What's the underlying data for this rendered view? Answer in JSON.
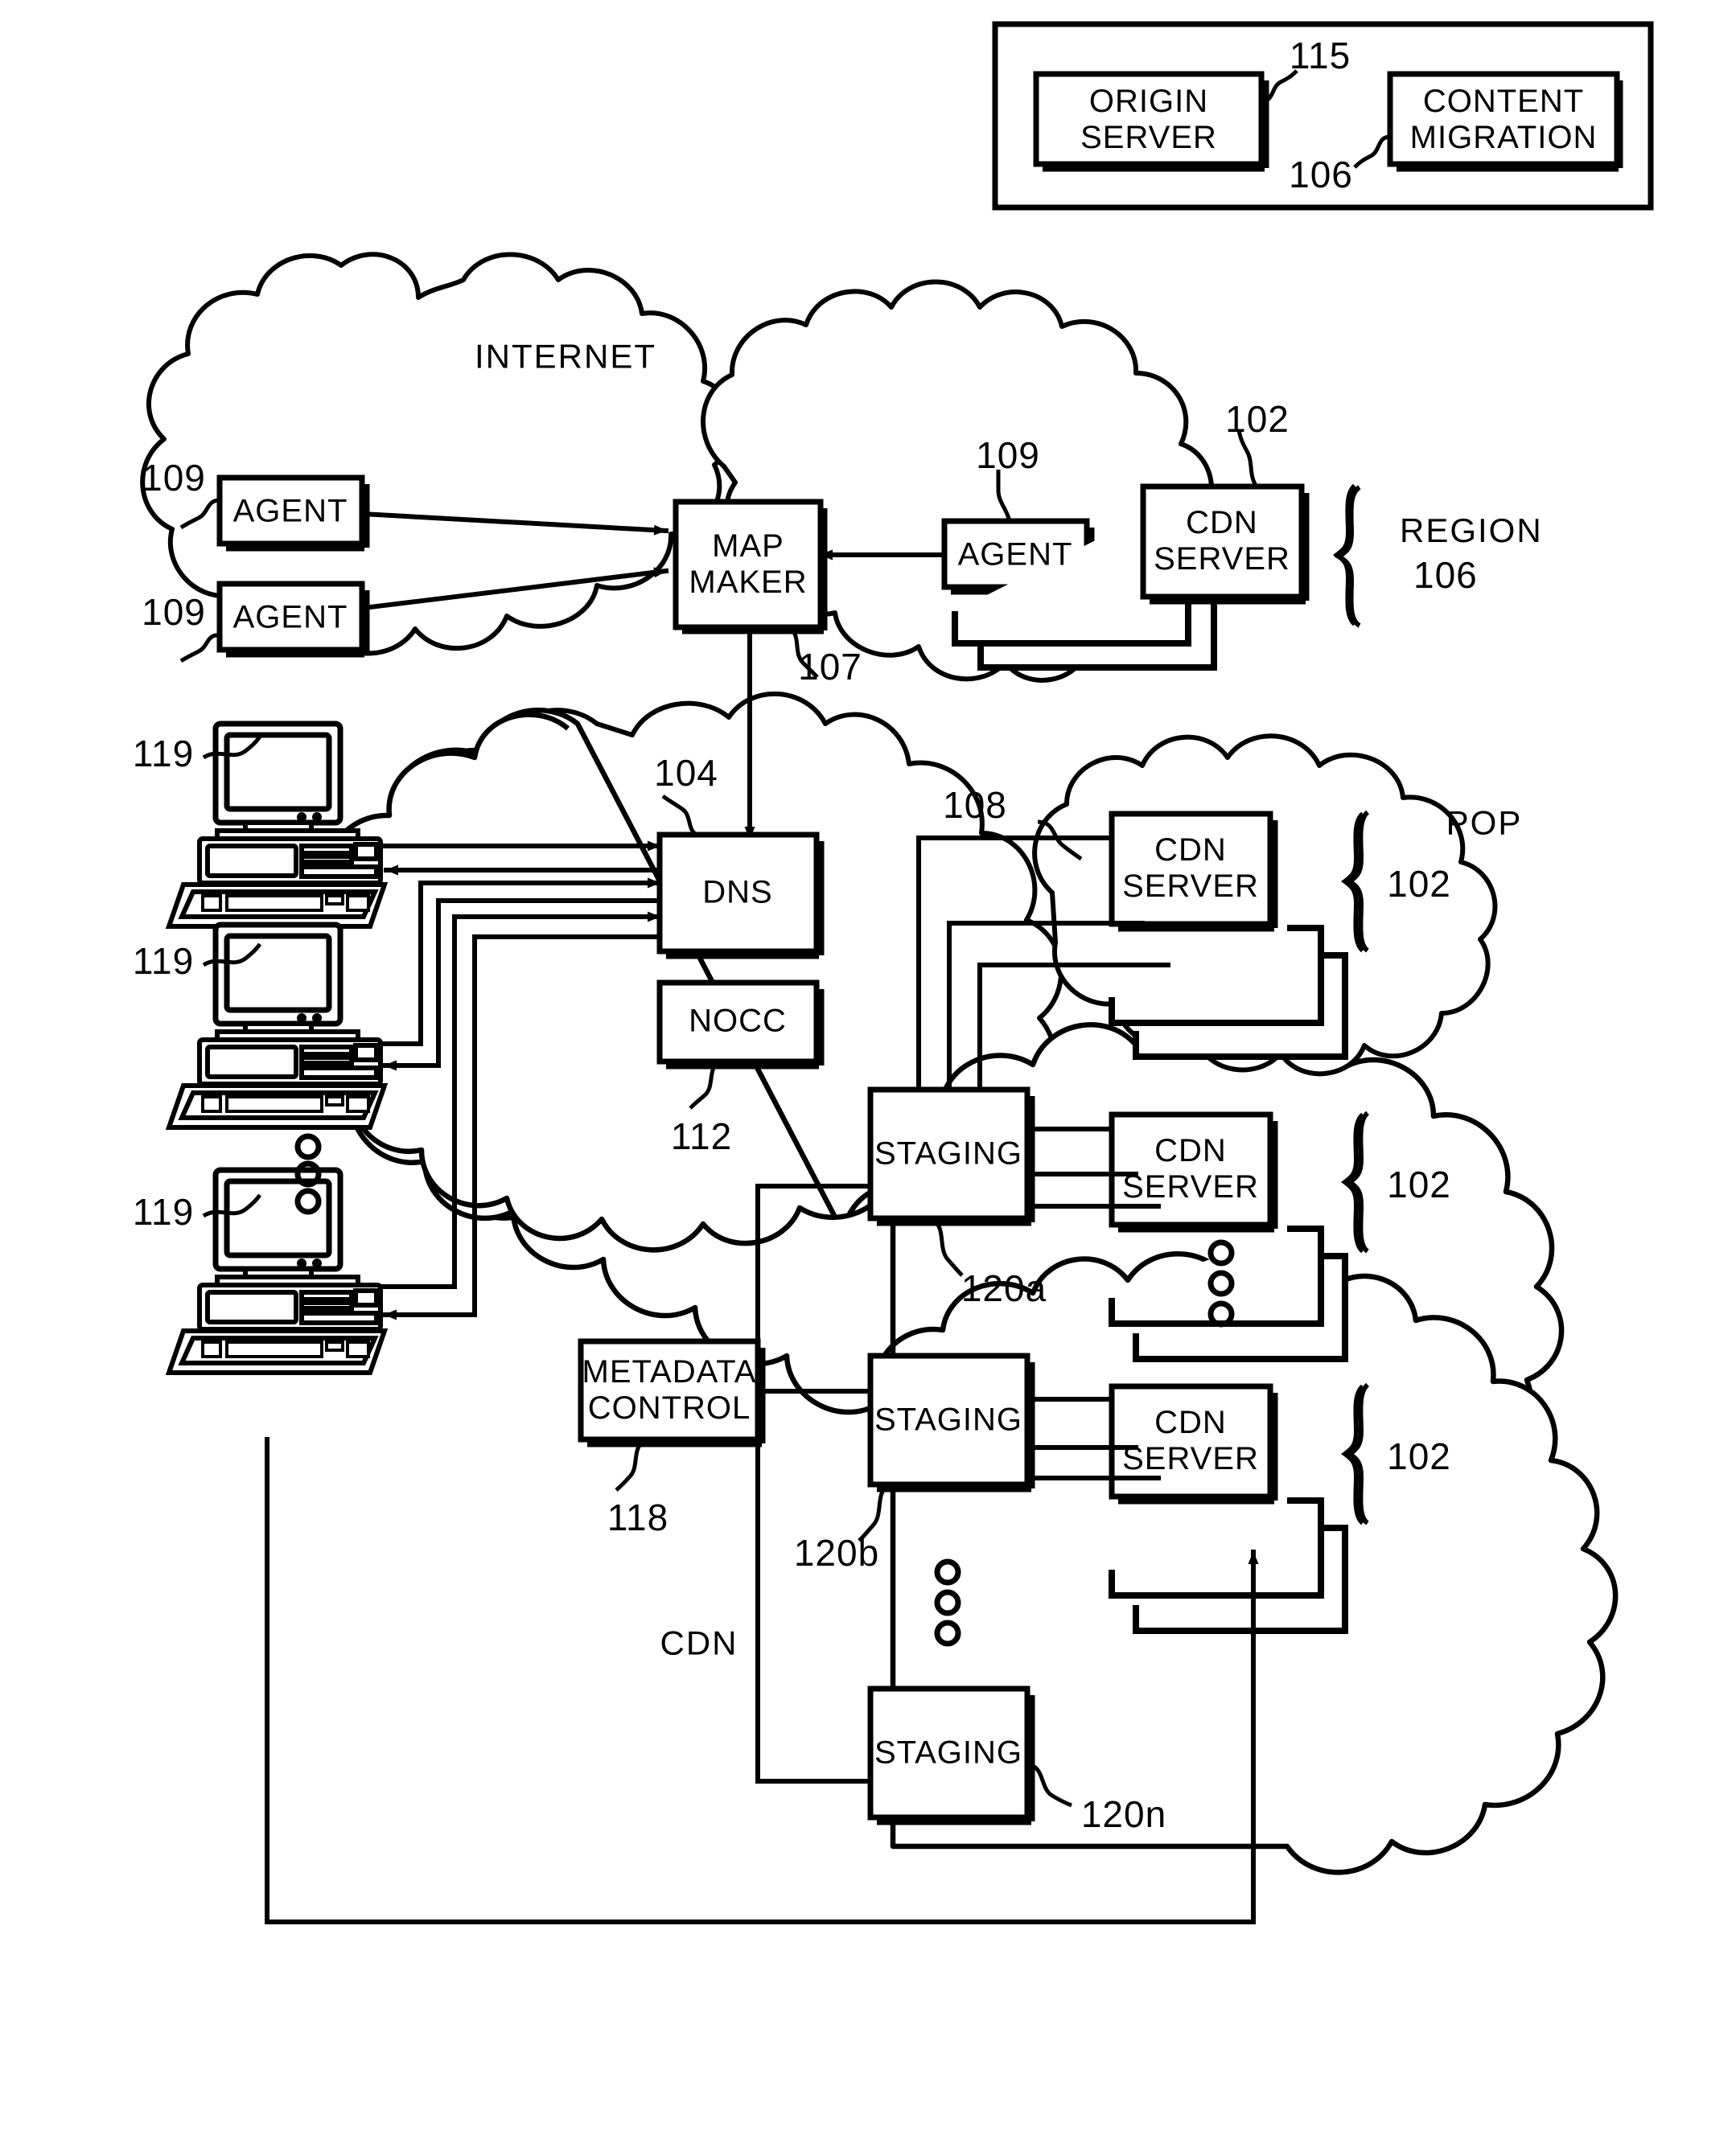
{
  "figure": {
    "type": "patent-network-diagram",
    "background": "#ffffff",
    "stroke": "#000000"
  },
  "top_panel": {
    "name": "top-enclosure",
    "boxes": [
      {
        "id": "origin-server",
        "label": "ORIGIN\nSERVER",
        "ref": "115"
      },
      {
        "id": "content-migration",
        "label": "CONTENT\nMIGRATION",
        "ref": "106"
      }
    ]
  },
  "clouds": [
    {
      "id": "internet-cloud",
      "label": "INTERNET"
    },
    {
      "id": "region-cloud",
      "label": ""
    },
    {
      "id": "cdn-cloud",
      "label": "CDN"
    },
    {
      "id": "pop-cloud",
      "label": "POP"
    }
  ],
  "internet": {
    "label": "INTERNET",
    "agents": [
      {
        "id": "agent-1",
        "label": "AGENT",
        "ref": "109"
      },
      {
        "id": "agent-2",
        "label": "AGENT",
        "ref": "109"
      },
      {
        "id": "agent-3",
        "label": "AGENT",
        "ref": "109"
      }
    ],
    "map_maker": {
      "label": "MAP\nMAKER",
      "ref": "107"
    },
    "region": {
      "cdn_server": {
        "label": "CDN\nSERVER",
        "ref": "102"
      },
      "brace_label": "REGION\n106",
      "brace_label_line1": "REGION",
      "brace_label_line2": "106"
    }
  },
  "cdn": {
    "label": "CDN",
    "dns": {
      "label": "DNS",
      "ref": "104"
    },
    "nocc": {
      "label": "NOCC",
      "ref": "112"
    },
    "metadata_control": {
      "label": "METADATA\nCONTROL",
      "ref": "118"
    },
    "staging": [
      {
        "id": "staging-a",
        "label": "STAGING",
        "ref": "120a"
      },
      {
        "id": "staging-b",
        "label": "STAGING",
        "ref": "120b"
      },
      {
        "id": "staging-n",
        "label": "STAGING",
        "ref": "120n"
      }
    ],
    "pop": {
      "label": "POP",
      "ref": "108"
    },
    "cdn_server_groups": [
      {
        "id": "cdn-server-pop",
        "label": "CDN\nSERVER",
        "ref": "102"
      },
      {
        "id": "cdn-server-mid",
        "label": "CDN\nSERVER",
        "ref": "102"
      },
      {
        "id": "cdn-server-low",
        "label": "CDN\nSERVER",
        "ref": "102"
      }
    ],
    "ellipsis_between_servers": "○ ○ ○",
    "ellipsis_between_staging": "○ ○ ○"
  },
  "clients": [
    {
      "id": "client-1",
      "label": "119"
    },
    {
      "id": "client-2",
      "label": "119"
    },
    {
      "id": "client-3",
      "label": "119"
    }
  ],
  "client_ellipsis": "○ ○ ○",
  "ref_numbers": {
    "origin_server": "115",
    "content_migration": "106",
    "agent_top": "109",
    "agent_bottom": "109",
    "agent_right": "109",
    "cdn_server_region": "102",
    "map_maker": "107",
    "dns": "104",
    "nocc": "112",
    "pop": "108",
    "cdn_server_pop": "102",
    "cdn_server_mid": "102",
    "cdn_server_low": "102",
    "staging_a": "120a",
    "staging_b": "120b",
    "staging_n": "120n",
    "metadata_control": "118",
    "client_1": "119",
    "client_2": "119",
    "client_3": "119"
  }
}
